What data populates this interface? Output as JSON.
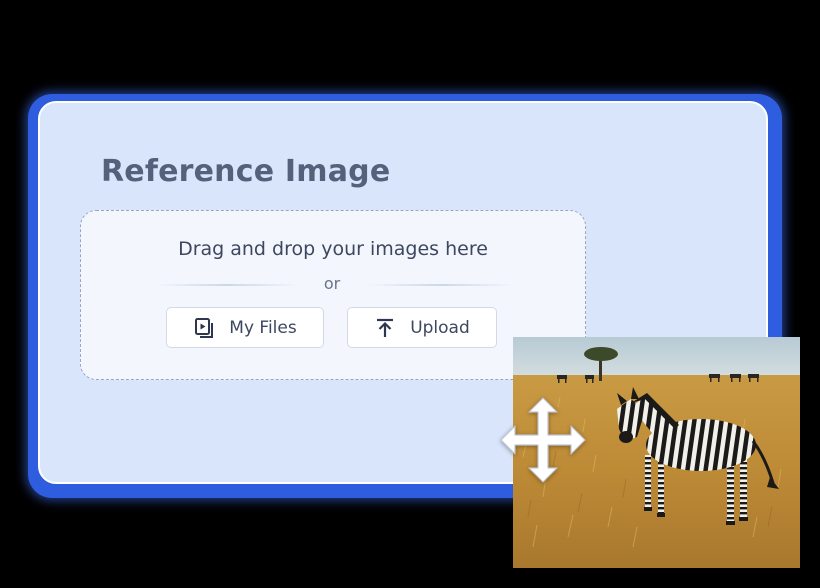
{
  "panel": {
    "title": "Reference Image"
  },
  "dropzone": {
    "instruction": "Drag and drop your images here",
    "separator": "or"
  },
  "buttons": {
    "my_files": {
      "label": "My Files",
      "icon": "my-files-icon"
    },
    "upload": {
      "label": "Upload",
      "icon": "upload-icon"
    }
  },
  "preview": {
    "subject": "zebra-photo",
    "overlay_icon": "move-icon"
  },
  "colors": {
    "frame_blue": "#2f5de0",
    "panel_bg": "#d8e5fb",
    "title_text": "#55607a",
    "body_text": "#3e4760"
  }
}
